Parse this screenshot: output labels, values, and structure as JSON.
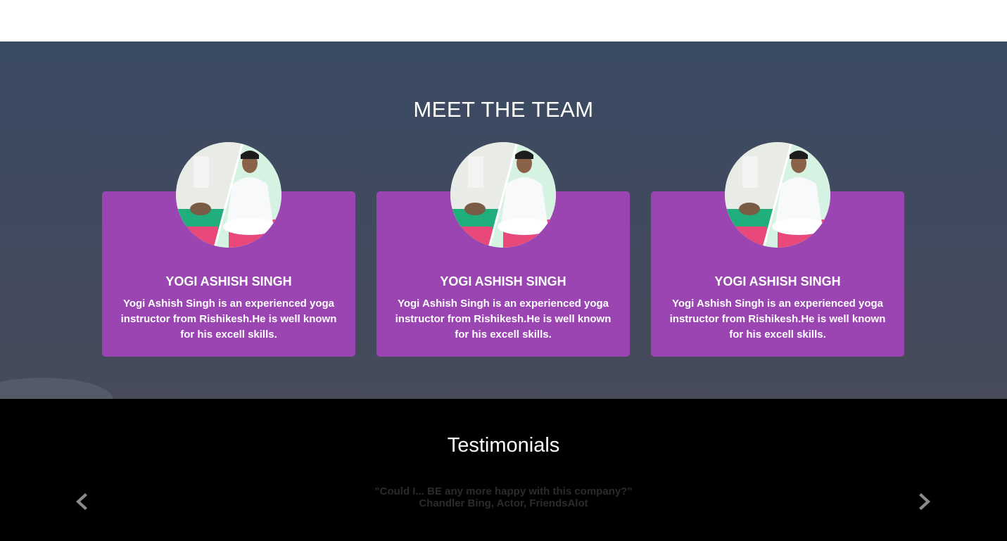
{
  "team": {
    "title": "MEET THE TEAM",
    "members": [
      {
        "name": "YOGI ASHISH SINGH",
        "bio": "Yogi Ashish Singh is an experienced yoga instructor from Rishikesh.He is well known for his excell skills."
      },
      {
        "name": "YOGI ASHISH SINGH",
        "bio": "Yogi Ashish Singh is an experienced yoga instructor from Rishikesh.He is well known for his excell skills."
      },
      {
        "name": "YOGI ASHISH SINGH",
        "bio": "Yogi Ashish Singh is an experienced yoga instructor from Rishikesh.He is well known for his excell skills."
      }
    ],
    "card_color": "#9b45b3"
  },
  "testimonials": {
    "title": "Testimonials",
    "quote": "\"Could I... BE any more happy with this company?\"",
    "author": "Chandler Bing, Actor, FriendsAlot",
    "prev_icon": "chevron-left-icon",
    "next_icon": "chevron-right-icon"
  }
}
